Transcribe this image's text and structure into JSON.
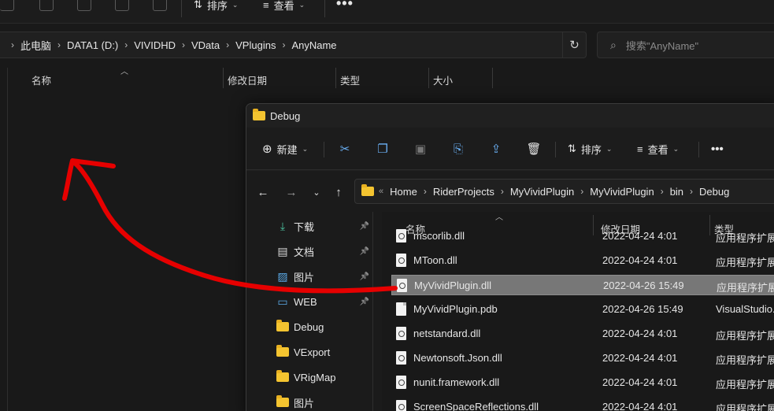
{
  "background_window": {
    "toolbar": {
      "sort_label": "排序",
      "view_label": "查看",
      "more": "•••"
    },
    "breadcrumb": [
      "此电脑",
      "DATA1 (D:)",
      "VIVIDHD",
      "VData",
      "VPlugins",
      "AnyName"
    ],
    "search_placeholder": "搜索\"AnyName\"",
    "columns": {
      "name": "名称",
      "modified": "修改日期",
      "type": "类型",
      "size": "大小"
    }
  },
  "debug_window": {
    "title": "Debug",
    "toolbar": {
      "new_label": "新建",
      "sort_label": "排序",
      "view_label": "查看",
      "more": "•••"
    },
    "breadcrumb": [
      "Home",
      "RiderProjects",
      "MyVividPlugin",
      "MyVividPlugin",
      "bin",
      "Debug"
    ],
    "sidebar": [
      {
        "label": "下载",
        "icon": "download-icon",
        "pinned": true
      },
      {
        "label": "文档",
        "icon": "document-icon",
        "pinned": true
      },
      {
        "label": "图片",
        "icon": "picture-icon",
        "pinned": true
      },
      {
        "label": "WEB",
        "icon": "monitor-icon",
        "pinned": true
      },
      {
        "label": "Debug",
        "icon": "folder-icon",
        "pinned": false
      },
      {
        "label": "VExport",
        "icon": "folder-icon",
        "pinned": false
      },
      {
        "label": "VRigMap",
        "icon": "folder-icon",
        "pinned": false
      },
      {
        "label": "图片",
        "icon": "folder-icon",
        "pinned": false
      }
    ],
    "columns": {
      "name": "名称",
      "modified": "修改日期",
      "type": "类型"
    },
    "files": [
      {
        "name": "mscorlib.dll",
        "date": "2022-04-24 4:01",
        "type": "应用程序扩展",
        "kind": "dll"
      },
      {
        "name": "MToon.dll",
        "date": "2022-04-24 4:01",
        "type": "应用程序扩展",
        "kind": "dll"
      },
      {
        "name": "MyVividPlugin.dll",
        "date": "2022-04-26 15:49",
        "type": "应用程序扩展",
        "kind": "dll",
        "selected": true
      },
      {
        "name": "MyVividPlugin.pdb",
        "date": "2022-04-26 15:49",
        "type": "VisualStudio.",
        "kind": "doc"
      },
      {
        "name": "netstandard.dll",
        "date": "2022-04-24 4:01",
        "type": "应用程序扩展",
        "kind": "dll"
      },
      {
        "name": "Newtonsoft.Json.dll",
        "date": "2022-04-24 4:01",
        "type": "应用程序扩展",
        "kind": "dll"
      },
      {
        "name": "nunit.framework.dll",
        "date": "2022-04-24 4:01",
        "type": "应用程序扩展",
        "kind": "dll"
      },
      {
        "name": "ScreenSpaceReflections.dll",
        "date": "2022-04-24 4:01",
        "type": "应用程序扩展",
        "kind": "dll"
      }
    ]
  },
  "annotation": {
    "arrow_color": "#e60000",
    "accent_folder": "#f4c430"
  }
}
